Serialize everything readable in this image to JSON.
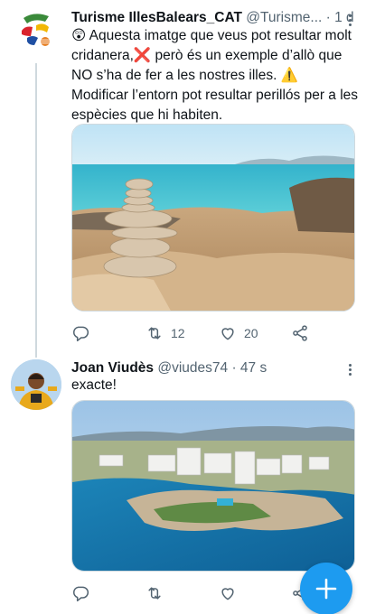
{
  "tweets": [
    {
      "display_name": "Turisme IllesBalears_CAT",
      "handle": "@Turisme...",
      "separator": "·",
      "time": "1 d",
      "text": "😲 Aquesta imatge que veus pot resultar molt cridanera,❌ però és un exemple d’allò que NO s’ha de fer a les nostres illes. ⚠️ Modificar l’entorn pot resultar perillós per a les espècies que hi habiten.",
      "retweets": "12",
      "likes": "20"
    },
    {
      "display_name": "Joan Viudès",
      "handle": "@viudes74",
      "separator": "·",
      "time": "47 s",
      "text": "exacte!",
      "retweets": "",
      "likes": ""
    }
  ],
  "icons": {
    "reply": "reply-icon",
    "retweet": "retweet-icon",
    "like": "heart-icon",
    "share": "share-icon",
    "more": "more-icon",
    "compose": "plus-icon"
  },
  "colors": {
    "accent": "#1d9bf0",
    "muted": "#536471",
    "text": "#0f1419"
  }
}
